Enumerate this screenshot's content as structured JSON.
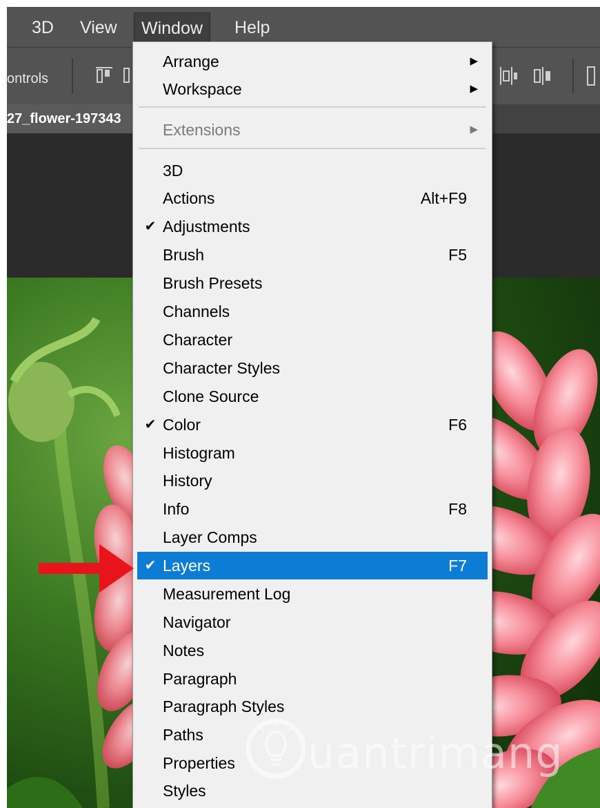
{
  "menubar": {
    "items": [
      "3D",
      "View",
      "Window",
      "Help"
    ],
    "active": "Window"
  },
  "options_bar": {
    "controls_label": "ontrols"
  },
  "document_tab": {
    "title": "27_flower-197343"
  },
  "window_menu": {
    "items": [
      {
        "label": "Arrange",
        "submenu": true
      },
      {
        "label": "Workspace",
        "submenu": true
      },
      {
        "label": "Extensions",
        "submenu": true,
        "disabled": true
      },
      {
        "label": "3D"
      },
      {
        "label": "Actions",
        "shortcut": "Alt+F9"
      },
      {
        "label": "Adjustments",
        "checked": true
      },
      {
        "label": "Brush",
        "shortcut": "F5"
      },
      {
        "label": "Brush Presets"
      },
      {
        "label": "Channels"
      },
      {
        "label": "Character"
      },
      {
        "label": "Character Styles"
      },
      {
        "label": "Clone Source"
      },
      {
        "label": "Color",
        "shortcut": "F6",
        "checked": true
      },
      {
        "label": "Histogram"
      },
      {
        "label": "History"
      },
      {
        "label": "Info",
        "shortcut": "F8"
      },
      {
        "label": "Layer Comps"
      },
      {
        "label": "Layers",
        "shortcut": "F7",
        "checked": true,
        "highlighted": true
      },
      {
        "label": "Measurement Log"
      },
      {
        "label": "Navigator"
      },
      {
        "label": "Notes"
      },
      {
        "label": "Paragraph"
      },
      {
        "label": "Paragraph Styles"
      },
      {
        "label": "Paths"
      },
      {
        "label": "Properties"
      },
      {
        "label": "Styles"
      }
    ]
  },
  "icons": {
    "check": "check-icon",
    "submenu": "chevron-right-icon",
    "annotation": "red-arrow-icon"
  },
  "colors": {
    "highlight": "#0c7cd5",
    "annotation_arrow": "#e8141b",
    "menubar": "#535353",
    "menu_bg": "#f0f0f0"
  },
  "watermark": {
    "text": "uantrimang"
  }
}
